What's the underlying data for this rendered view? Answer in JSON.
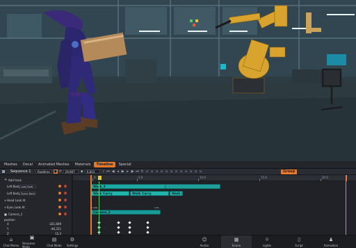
{
  "tabs": [
    {
      "label": "Meshes"
    },
    {
      "label": "Decal"
    },
    {
      "label": "Animated Meshes"
    },
    {
      "label": "Materials"
    },
    {
      "label": "Timeline",
      "active": true
    },
    {
      "label": "Special"
    }
  ],
  "transport": {
    "sequence": "Sequence 1",
    "field_a": "Realtime",
    "field_b": "29,967",
    "field_c": "0,833",
    "group_label": "Group"
  },
  "tracks": {
    "add_track": "Add track",
    "rows": [
      {
        "label": "Left Body",
        "dropdown": "Look Body"
      },
      {
        "label": "Left Body",
        "dropdown": "Space Body"
      },
      {
        "label": "Head Look At",
        "dropdown": ""
      },
      {
        "label": "Eyes Look At",
        "dropdown": ""
      },
      {
        "label": "Camera_1",
        "dropdown": ""
      },
      {
        "label": "position",
        "value": ""
      },
      {
        "label": "X",
        "value": "-321,609"
      },
      {
        "label": "Y",
        "value": "-46,311"
      },
      {
        "label": "Z",
        "value": "15,3"
      }
    ]
  },
  "timeline": {
    "ruler": [
      "0",
      "5.0",
      "10.0",
      "15.0",
      "20.0"
    ],
    "clips": {
      "walk": "Walk_3",
      "carry1": "Walk Carry",
      "carry2": "Walk Carry",
      "carry3": "Walk Ca",
      "camera": "Camera_2",
      "camera_start": "1:00s",
      "camera_end": "1:5s"
    }
  },
  "bottom_nav": [
    {
      "label": "Chat Memo",
      "icon": "home-icon"
    },
    {
      "label": "Streamer Mode",
      "icon": "streamer-icon"
    },
    {
      "label": "Chat Mode",
      "icon": "chat-icon"
    },
    {
      "label": "Settings",
      "icon": "gear-icon"
    },
    {
      "label": "Avatar",
      "icon": "avatar-icon"
    },
    {
      "label": "Scene",
      "icon": "scene-icon",
      "active": true
    },
    {
      "label": "Lights",
      "icon": "light-icon"
    },
    {
      "label": "Script",
      "icon": "script-icon"
    },
    {
      "label": "Animation",
      "icon": "animation-icon"
    }
  ],
  "colors": {
    "accent": "#e8792c",
    "clip": "#1ea9a4",
    "playhead": "#48d062"
  }
}
